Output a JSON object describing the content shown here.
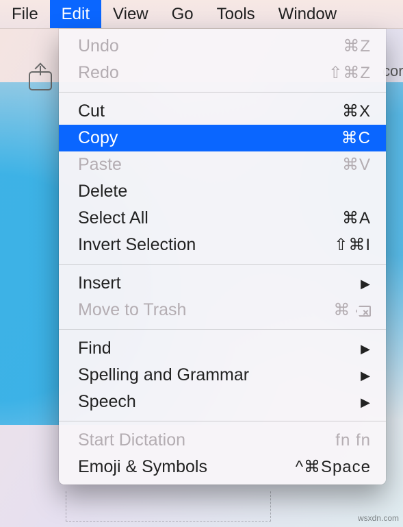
{
  "menubar": {
    "items": [
      {
        "label": "File",
        "active": false
      },
      {
        "label": "Edit",
        "active": true
      },
      {
        "label": "View",
        "active": false
      },
      {
        "label": "Go",
        "active": false
      },
      {
        "label": "Tools",
        "active": false
      },
      {
        "label": "Window",
        "active": false
      }
    ]
  },
  "dropdown": {
    "groups": [
      [
        {
          "label": "Undo",
          "shortcut": "⌘Z",
          "disabled": true
        },
        {
          "label": "Redo",
          "shortcut": "⇧⌘Z",
          "disabled": true
        }
      ],
      [
        {
          "label": "Cut",
          "shortcut": "⌘X"
        },
        {
          "label": "Copy",
          "shortcut": "⌘C",
          "highlighted": true
        },
        {
          "label": "Paste",
          "shortcut": "⌘V",
          "disabled": true
        },
        {
          "label": "Delete",
          "shortcut": ""
        },
        {
          "label": "Select All",
          "shortcut": "⌘A"
        },
        {
          "label": "Invert Selection",
          "shortcut": "⇧⌘I"
        }
      ],
      [
        {
          "label": "Insert",
          "submenu": true
        },
        {
          "label": "Move to Trash",
          "shortcut": "⌘",
          "delete_glyph": true,
          "disabled": true
        }
      ],
      [
        {
          "label": "Find",
          "submenu": true
        },
        {
          "label": "Spelling and Grammar",
          "submenu": true
        },
        {
          "label": "Speech",
          "submenu": true
        }
      ],
      [
        {
          "label": "Start Dictation",
          "shortcut": "fn fn",
          "disabled": true
        },
        {
          "label": "Emoji & Symbols",
          "shortcut": "^⌘Space"
        }
      ]
    ]
  },
  "hints": {
    "icons_text": "cor"
  },
  "watermark": "wsxdn.com"
}
